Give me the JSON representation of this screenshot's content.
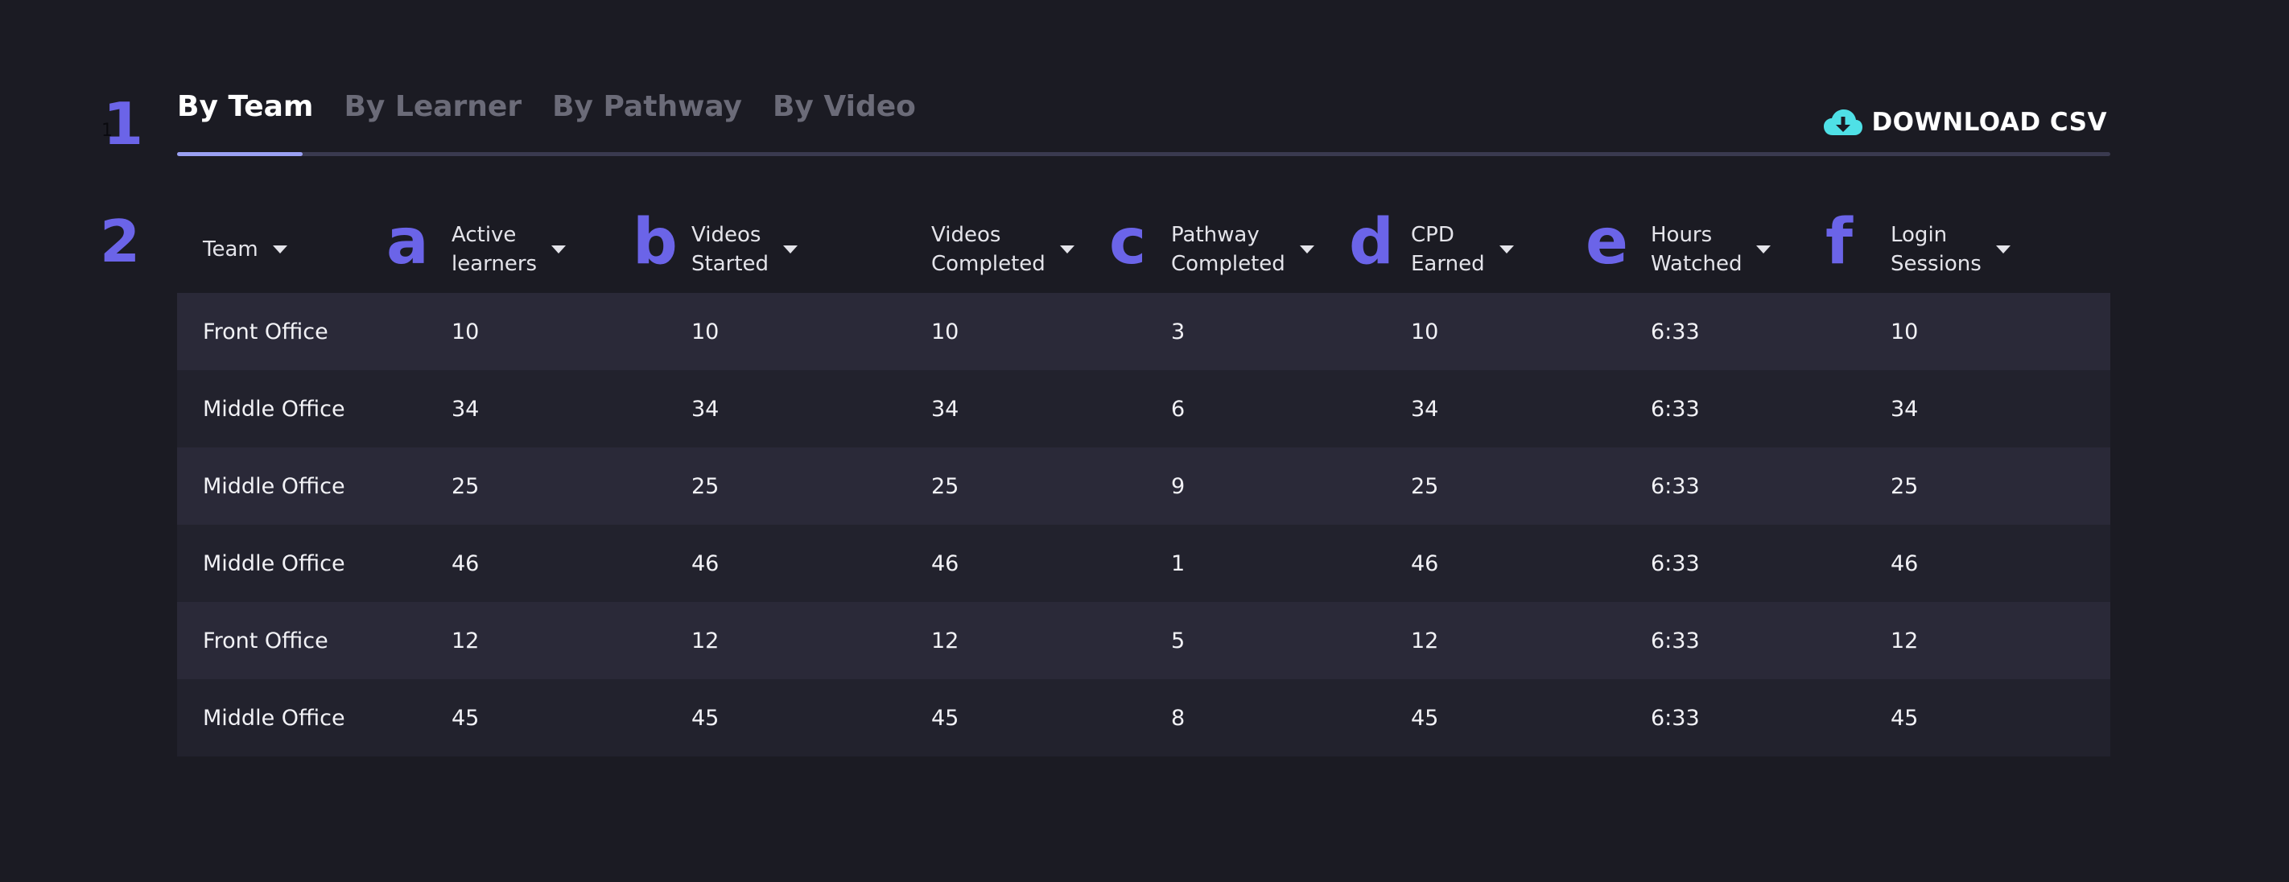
{
  "markers": {
    "one": "1",
    "one_small": "1",
    "two": "2",
    "letters": [
      "a",
      "b",
      "c",
      "d",
      "e",
      "f"
    ]
  },
  "tabs": [
    {
      "label": "By Team",
      "active": true
    },
    {
      "label": "By Learner",
      "active": false
    },
    {
      "label": "By Pathway",
      "active": false
    },
    {
      "label": "By Video",
      "active": false
    }
  ],
  "download": {
    "label": "DOWNLOAD CSV",
    "icon": "cloud-download-icon",
    "icon_color": "#4fe0e6"
  },
  "colors": {
    "accent": "#6b64e8",
    "tab_indicator": "#9aa0f2",
    "row_odd": "#2a2938",
    "row_even": "#22222d"
  },
  "table": {
    "columns": [
      "Team",
      "Active\nlearners",
      "Videos\nStarted",
      "Videos\nCompleted",
      "Pathway\nCompleted",
      "CPD\nEarned",
      "Hours\nWatched",
      "Login\nSessions"
    ],
    "rows": [
      [
        "Front Office",
        "10",
        "10",
        "10",
        "3",
        "10",
        "6:33",
        "10"
      ],
      [
        "Middle Office",
        "34",
        "34",
        "34",
        "6",
        "34",
        "6:33",
        "34"
      ],
      [
        "Middle Office",
        "25",
        "25",
        "25",
        "9",
        "25",
        "6:33",
        "25"
      ],
      [
        "Middle Office",
        "46",
        "46",
        "46",
        "1",
        "46",
        "6:33",
        "46"
      ],
      [
        "Front Office",
        "12",
        "12",
        "12",
        "5",
        "12",
        "6:33",
        "12"
      ],
      [
        "Middle Office",
        "45",
        "45",
        "45",
        "8",
        "45",
        "6:33",
        "45"
      ]
    ]
  }
}
